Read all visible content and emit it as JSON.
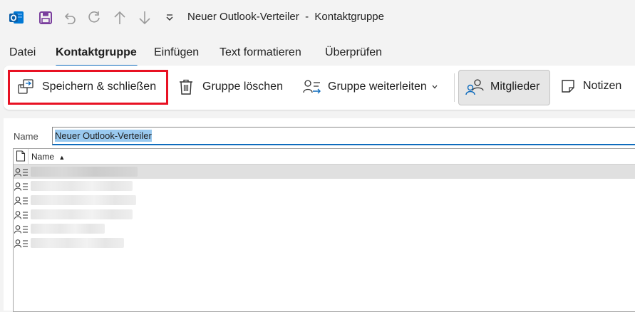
{
  "window": {
    "title": "Neuer Outlook-Verteiler  -  Kontaktgruppe",
    "app_icon": "outlook-icon",
    "toolbar_icons": [
      "save-icon",
      "undo-icon",
      "redo-icon",
      "arrow-up-icon",
      "arrow-down-icon",
      "customize-dropdown-icon"
    ]
  },
  "tabs": [
    {
      "label": "Datei"
    },
    {
      "label": "Kontaktgruppe",
      "active": true
    },
    {
      "label": "Einfügen"
    },
    {
      "label": "Text formatieren"
    },
    {
      "label": "Überprüfen"
    }
  ],
  "ribbon": {
    "save_close": "Speichern & schließen",
    "delete_group": "Gruppe löschen",
    "forward_group": "Gruppe weiterleiten",
    "members": "Mitglieder",
    "notes": "Notizen"
  },
  "form": {
    "name_label": "Name",
    "name_value": "Neuer Outlook-Verteiler"
  },
  "list": {
    "header_name": "Name",
    "sort_indicator": "▲",
    "rows": [
      {
        "name": "",
        "selected": true
      },
      {
        "name": ""
      },
      {
        "name": ""
      },
      {
        "name": ""
      },
      {
        "name": ""
      },
      {
        "name": ""
      }
    ]
  },
  "colors": {
    "accent": "#0f6cbd",
    "highlight_red": "#e81123",
    "outlook_blue": "#0078d4",
    "save_purple": "#7a3e9d"
  }
}
